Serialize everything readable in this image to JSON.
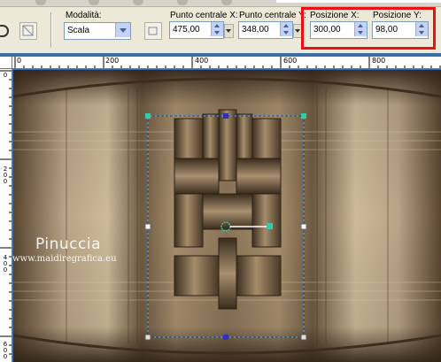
{
  "toolbar": {
    "mode_label": "Modalità:",
    "mode_value": "Scala",
    "center_x_label": "Punto centrale X:",
    "center_x_value": "475,00",
    "center_y_label": "Punto centrale Y:",
    "center_y_value": "348,00",
    "pos_x_label": "Posizione X:",
    "pos_x_value": "300,00",
    "pos_y_label": "Posizione Y:",
    "pos_y_value": "98,00"
  },
  "ruler": {
    "h_ticks": [
      "0",
      "200",
      "400",
      "600",
      "800"
    ],
    "v_ticks": [
      "0",
      "2\n0\n0",
      "4\n0\n0",
      "6\n0\n0"
    ]
  },
  "watermark": {
    "title": "Pinuccia",
    "url": "www.maidiregrafica.eu"
  },
  "colors": {
    "highlight": "#ee1010",
    "window_blue": "#3a6ea5",
    "handle_teal": "#35c9a8",
    "handle_blue": "#3030c0"
  }
}
